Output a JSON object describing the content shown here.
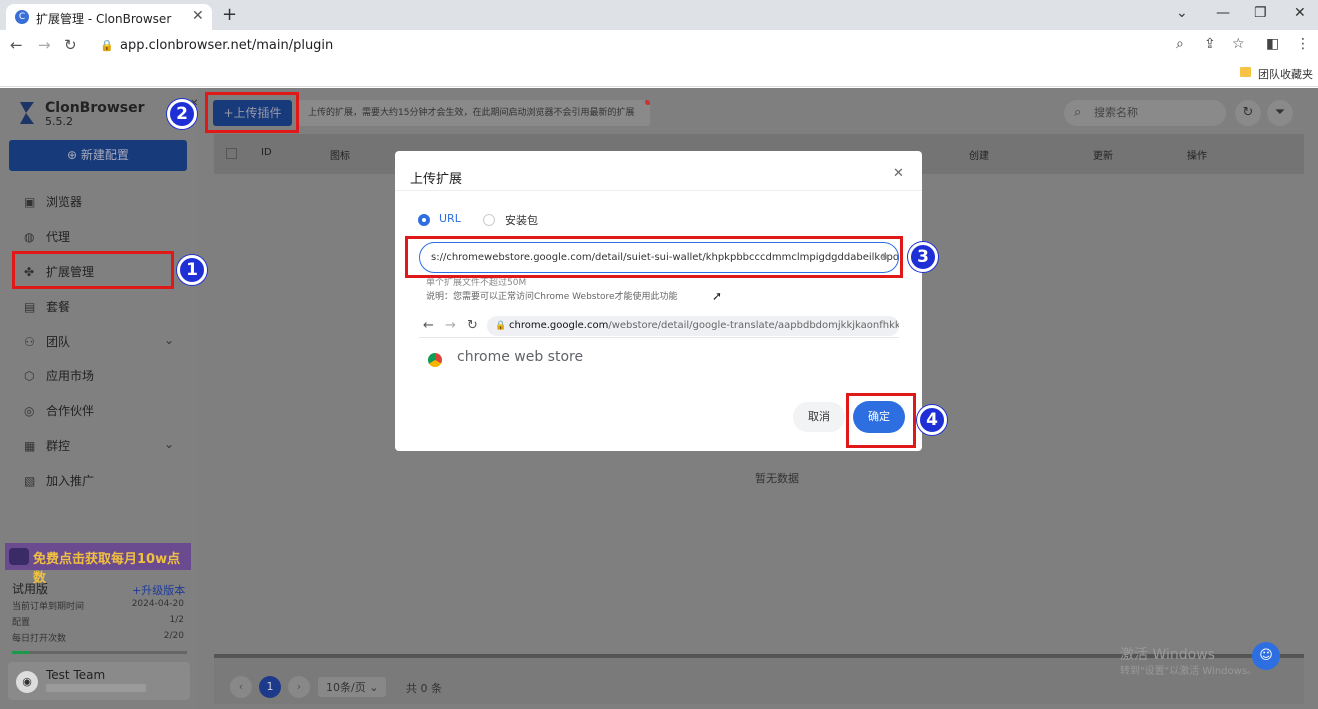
{
  "browser": {
    "tab_title": "扩展管理 - ClonBrowser",
    "url": "app.clonbrowser.net/main/plugin",
    "bookmark": "团队收藏夹"
  },
  "app": {
    "brand": "ClonBrowser",
    "version": "5.5.2",
    "new_config": "新建配置",
    "nav": [
      "浏览器",
      "代理",
      "扩展管理",
      "套餐",
      "团队",
      "应用市场",
      "合作伙伴",
      "群控",
      "加入推广"
    ],
    "promo": "免费点击获取每月10w点数",
    "plan": {
      "name": "试用版",
      "upgrade": "+升级版本",
      "rows": [
        {
          "label": "当前订单到期时间",
          "value": "2024-04-20"
        },
        {
          "label": "配置",
          "value": "1/2"
        },
        {
          "label": "每日打开次数",
          "value": "2/20"
        }
      ],
      "progress": 0.1
    },
    "user": "Test Team"
  },
  "main": {
    "upload_button": "+上传插件",
    "notice": "上传的扩展，需要大约15分钟才会生效，在此期间启动浏览器不会引用最新的扩展",
    "search_placeholder": "搜索名称",
    "columns": [
      "ID",
      "图标",
      "创建",
      "更新",
      "操作"
    ],
    "empty": "暂无数据",
    "pager": {
      "page": "1",
      "per_page": "10条/页",
      "total": "共 0 条"
    }
  },
  "modal": {
    "title": "上传扩展",
    "radio_url": "URL",
    "radio_pkg": "安装包",
    "url_value": "s://chromewebstore.google.com/detail/suiet-sui-wallet/khpkpbbcccdmmclmpigdgddabeilkdpd",
    "hint1": "单个扩展文件不超过50M",
    "hint2": "说明：您需要可以正常访问Chrome Webstore才能使用此功能",
    "preview_url_host": "chrome.google.com",
    "preview_url_path": "/webstore/detail/google-translate/aapbdbdomjkkjkaonfhkkik...",
    "store_name": "chrome web store",
    "cancel": "取消",
    "confirm": "确定"
  },
  "watermark": {
    "line1": "激活 Windows",
    "line2": "转到\"设置\"以激活 Windows。"
  },
  "badges": [
    "1",
    "2",
    "3",
    "4"
  ]
}
